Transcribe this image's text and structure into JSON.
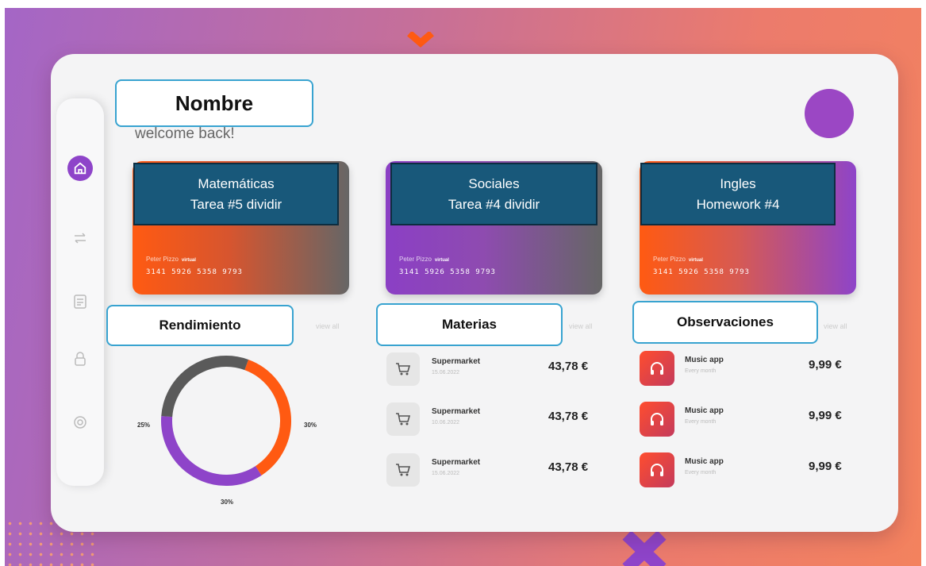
{
  "header": {
    "name_label": "Nombre",
    "welcome": "welcome back!"
  },
  "sidebar": {
    "items": [
      {
        "icon": "home-icon",
        "active": true
      },
      {
        "icon": "transfer-icon",
        "active": false
      },
      {
        "icon": "document-icon",
        "active": false
      },
      {
        "icon": "lock-icon",
        "active": false
      },
      {
        "icon": "settings-icon",
        "active": false
      }
    ]
  },
  "cards": [
    {
      "line1": "Matemáticas",
      "line2": "Tarea #5 dividir",
      "holder": "Peter Pizzo",
      "tag": "virtual",
      "number": "3141 5926 5358 9793"
    },
    {
      "line1": "Sociales",
      "line2": "Tarea #4 dividir",
      "holder": "Peter Pizzo",
      "tag": "virtual",
      "number": "3141 5926 5358 9793"
    },
    {
      "line1": "Ingles",
      "line2": "Homework #4",
      "holder": "Peter Pizzo",
      "tag": "virtual",
      "number": "3141 5926 5358 9793"
    }
  ],
  "sections": {
    "rendimiento": "Rendimiento",
    "materias": "Materias",
    "observaciones": "Observaciones",
    "view_all": "view all"
  },
  "chart_data": {
    "type": "pie",
    "style": "donut",
    "segments": [
      {
        "label": "25%",
        "value": 25,
        "color": "#5a5a5a"
      },
      {
        "label": "30%",
        "value": 30,
        "color": "#8e44c9"
      },
      {
        "label": "30%",
        "value": 30,
        "color": "#ff5a12"
      }
    ]
  },
  "materias": [
    {
      "title": "Supermarket",
      "date": "15.06.2022",
      "amount": "43,78 €"
    },
    {
      "title": "Supermarket",
      "date": "10.06.2022",
      "amount": "43,78 €"
    },
    {
      "title": "Supermarket",
      "date": "15.06.2022",
      "amount": "43,78 €"
    }
  ],
  "observaciones": [
    {
      "title": "Music app",
      "sub": "Every month",
      "amount": "9,99 €"
    },
    {
      "title": "Music app",
      "sub": "Every month",
      "amount": "9,99 €"
    },
    {
      "title": "Music app",
      "sub": "Every month",
      "amount": "9,99 €"
    }
  ],
  "colors": {
    "accent_purple": "#8e44c9",
    "accent_orange": "#ff5a12",
    "note_bg": "#18587a",
    "label_border": "#38a3d0"
  }
}
